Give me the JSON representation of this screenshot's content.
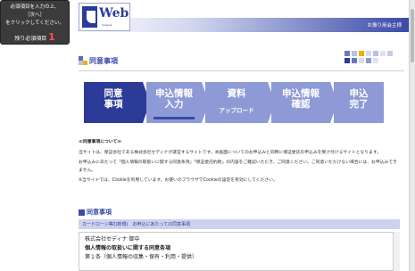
{
  "notice": {
    "line1": "必須項目を入力の上、",
    "line2": "［次へ］",
    "line3": "をクリックしてください。",
    "remaining_label": "残り必須項目",
    "remaining_count": "1"
  },
  "header": {
    "logo_text": "Web",
    "logo_small": "Cedyna",
    "bar_text": "お振り用会主様"
  },
  "section": {
    "title": "同意事項"
  },
  "steps": [
    {
      "l1": "同意",
      "l2": "事項"
    },
    {
      "l1": "申込情報",
      "l2": "入力"
    },
    {
      "l1": "資料",
      "sub": "アップロード"
    },
    {
      "l1": "申込情報",
      "l2": "確認"
    },
    {
      "l1": "申込",
      "l2": "完了"
    }
  ],
  "intro": {
    "heading": "≪同意事項について≫",
    "p1": "当サイトは、保証会社である株式会社セディナが運営するサイトです。本画面についてのお申込みと同時に保証委託の申込みを受け付けるサイトとなります。",
    "p2": "お申込みにあたって「個人情報の取扱いに関する同意条項」「保証委託約款」の内容をご確認いただき、ご同意ください。ご同意いただけない場合には、お申込みできません。",
    "p3": "※当サイトでは、Cookieを利用しています。お使いのブラウザでCookieの設定を有効にしてください。"
  },
  "consent": {
    "title": "同意事項",
    "subbar": "カードローン等ζ(新規)　お申込にあたっての同意事項",
    "line1": "株式会社セディナ 御中",
    "line2": "個人情報の取扱いに関する同意条項",
    "line3": "第１条（個人情報の収集・保有・利用・提供）"
  },
  "colors": {
    "brand": "#2a3b9d",
    "step_active": "#2c3a98",
    "step_inactive": "#8e9ad6",
    "alert_count": "#ff4f4f"
  }
}
